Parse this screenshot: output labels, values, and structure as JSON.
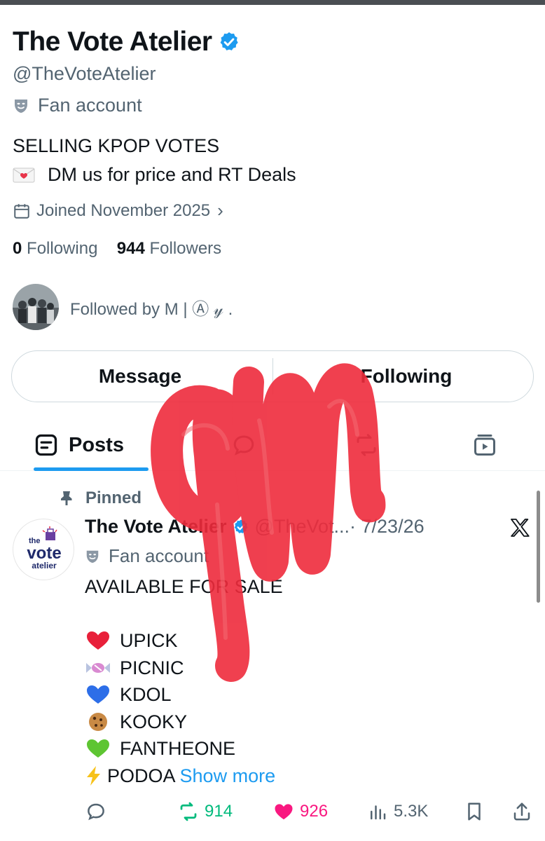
{
  "profile": {
    "display_name": "The Vote Atelier",
    "handle": "@TheVoteAtelier",
    "category": "Fan account",
    "bio_line1": "SELLING KPOP VOTES",
    "bio_line2": "DM us for price and RT Deals",
    "joined": "Joined November 2025",
    "following_count": "0",
    "following_label": "Following",
    "followers_count": "944",
    "followers_label": "Followers",
    "followed_by": "Followed by M | Ⓐ 𝓎 ."
  },
  "buttons": {
    "message": "Message",
    "following": "Following"
  },
  "tabs": {
    "posts": "Posts"
  },
  "post": {
    "pinned_label": "Pinned",
    "author_name": "The Vote Atelier",
    "author_handle": "@TheVot...",
    "date": "· 7/23/26",
    "category": "Fan account",
    "avatar_text": {
      "top": "the",
      "main": "vote",
      "bottom": "atelier"
    },
    "headline": "AVAILABLE FOR SALE",
    "apps": [
      {
        "emoji": "red-heart",
        "name": "UPICK"
      },
      {
        "emoji": "candy",
        "name": "PICNIC"
      },
      {
        "emoji": "blue-heart",
        "name": "KDOL"
      },
      {
        "emoji": "cookie",
        "name": "KOOKY"
      },
      {
        "emoji": "green-heart",
        "name": "FANTHEONE"
      },
      {
        "emoji": "lightning",
        "name": "PODOA"
      }
    ],
    "show_more": "Show more",
    "stats": {
      "retweets": "914",
      "likes": "926",
      "views": "5.3K"
    }
  },
  "colors": {
    "accent": "#1d9bf0",
    "retweet": "#00ba7c",
    "like": "#f91880",
    "muted": "#536471",
    "scribble": "#ee2b3c"
  }
}
